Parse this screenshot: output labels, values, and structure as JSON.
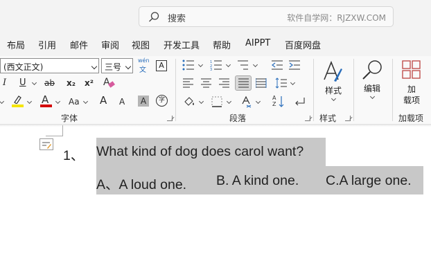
{
  "search": {
    "placeholder": "搜索",
    "watermark": "软件自学网：RJZXW.COM"
  },
  "menu_tabs": [
    "布局",
    "引用",
    "邮件",
    "审阅",
    "视图",
    "开发工具",
    "帮助",
    "AIPPT",
    "百度网盘"
  ],
  "ribbon": {
    "font": {
      "font_name": "(西文正文)",
      "font_size": "三号",
      "phonetic_top": "wén",
      "phonetic_bottom": "文",
      "char_border": "A",
      "italic": "I",
      "underline": "U",
      "strikethrough": "ab",
      "subscript": "x₂",
      "superscript": "x²",
      "clear_format": "A",
      "font_color": "A",
      "change_case": "Aa",
      "grow_font": "A",
      "shrink_font": "A",
      "shading": "A",
      "enclose": "字",
      "group_label": "字体"
    },
    "paragraph": {
      "group_label": "段落",
      "sort": "AZ"
    },
    "styles": {
      "button_label": "样式",
      "group_label": "样式"
    },
    "editing": {
      "button_label": "编辑"
    },
    "addins": {
      "button_line1": "加",
      "button_line2": "载项",
      "group_label": "加载项"
    },
    "colors": {
      "highlight": "#f5e500",
      "font_color": "#d40000",
      "accent": "#c0504d"
    }
  },
  "document": {
    "question_number": "1、",
    "question": "What kind of dog does carol want?",
    "options": [
      "A、A loud one.",
      "B. A kind one.",
      "C.A large one."
    ],
    "selection_color": "#c8c8c8"
  }
}
